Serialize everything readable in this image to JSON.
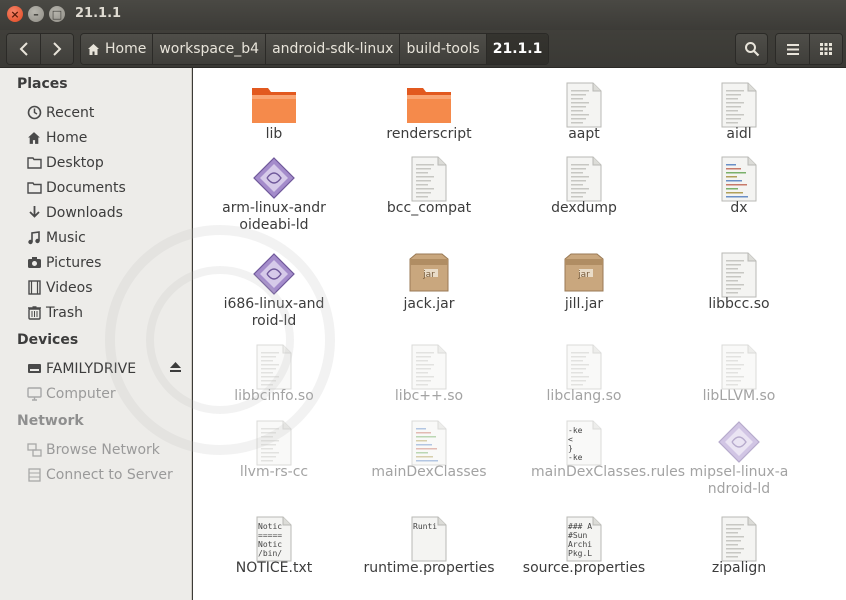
{
  "window": {
    "title": "21.1.1"
  },
  "toolbar": {
    "breadcrumbs": [
      "Home",
      "workspace_b4",
      "android-sdk-linux",
      "build-tools",
      "21.1.1"
    ]
  },
  "sidebar": {
    "places_heading": "Places",
    "places": [
      "Recent",
      "Home",
      "Desktop",
      "Documents",
      "Downloads",
      "Music",
      "Pictures",
      "Videos",
      "Trash"
    ],
    "devices_heading": "Devices",
    "devices": [
      "FAMILYDRIVE",
      "Computer"
    ],
    "network_heading": "Network",
    "network": [
      "Browse Network",
      "Connect to Server"
    ]
  },
  "files": [
    {
      "name": "lib",
      "kind": "folder"
    },
    {
      "name": "renderscript",
      "kind": "folder"
    },
    {
      "name": "aapt",
      "kind": "doc"
    },
    {
      "name": "aidl",
      "kind": "doc"
    },
    {
      "name": "arm-linux-androideabi-ld",
      "kind": "exec"
    },
    {
      "name": "bcc_compat",
      "kind": "doc"
    },
    {
      "name": "dexdump",
      "kind": "doc"
    },
    {
      "name": "dx",
      "kind": "script"
    },
    {
      "name": "i686-linux-android-ld",
      "kind": "exec"
    },
    {
      "name": "jack.jar",
      "kind": "jar"
    },
    {
      "name": "jill.jar",
      "kind": "jar"
    },
    {
      "name": "libbcc.so",
      "kind": "doc"
    },
    {
      "name": "libbcinfo.so",
      "kind": "doc"
    },
    {
      "name": "libc++.so",
      "kind": "doc"
    },
    {
      "name": "libclang.so",
      "kind": "doc"
    },
    {
      "name": "libLLVM.so",
      "kind": "doc"
    },
    {
      "name": "llvm-rs-cc",
      "kind": "doc"
    },
    {
      "name": "mainDexClasses",
      "kind": "script"
    },
    {
      "name": "mainDexClasses.rules",
      "kind": "text"
    },
    {
      "name": "mipsel-linux-android-ld",
      "kind": "exec"
    },
    {
      "name": "NOTICE.txt",
      "kind": "text"
    },
    {
      "name": "runtime.properties",
      "kind": "text"
    },
    {
      "name": "source.properties",
      "kind": "text"
    },
    {
      "name": "zipalign",
      "kind": "doc"
    }
  ],
  "icon_text": {
    "jar_tag": "jar",
    "rules_preview": [
      "-ke",
      "<",
      "}",
      "-ke"
    ],
    "notice_preview": [
      "Notic",
      "=====",
      "Notic",
      "/bin/"
    ],
    "runtime_preview": [
      "Runti"
    ],
    "source_preview": [
      "### A",
      "#Sun",
      "Archi",
      "Pkg.L"
    ]
  },
  "colors": {
    "folder": "#f07a3a",
    "selection": "#f07746",
    "exec": "#8b6fb0"
  }
}
